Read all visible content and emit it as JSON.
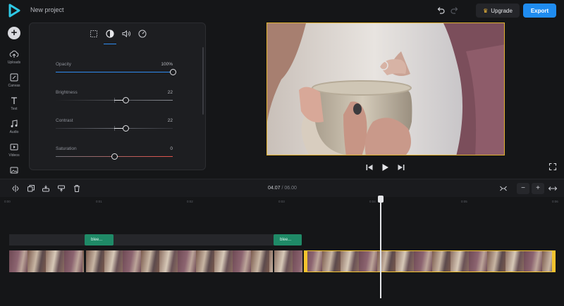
{
  "header": {
    "project_title": "New project",
    "upgrade_label": "Upgrade",
    "export_label": "Export",
    "accent_color": "#1f8cf0"
  },
  "sidebar": {
    "items": [
      {
        "label": "Uploads",
        "icon": "upload-icon"
      },
      {
        "label": "Canvas",
        "icon": "canvas-icon"
      },
      {
        "label": "Text",
        "icon": "text-icon"
      },
      {
        "label": "Audio",
        "icon": "music-icon"
      },
      {
        "label": "Videos",
        "icon": "video-icon"
      },
      {
        "label": "",
        "icon": "image-icon"
      }
    ]
  },
  "adjust_panel": {
    "tabs": [
      "crop-icon",
      "contrast-icon",
      "volume-icon",
      "speed-icon"
    ],
    "active_tab": 1,
    "sliders": [
      {
        "name": "Opacity",
        "value": "100%",
        "fraction": 1.0,
        "color": "#2f8cf2"
      },
      {
        "name": "Brightness",
        "value": "22",
        "fraction": 0.6,
        "color": "#e6e7ea"
      },
      {
        "name": "Contrast",
        "value": "22",
        "fraction": 0.6,
        "color": "#e6e7ea"
      },
      {
        "name": "Saturation",
        "value": "0",
        "fraction": 0.5,
        "color": "#e5534b"
      }
    ]
  },
  "timeline": {
    "current_time": "04.07",
    "separator": "/",
    "duration": "06.00",
    "ruler": [
      "0:00",
      "0:01",
      "0:02",
      "0:03",
      "0:04",
      "0:05",
      "0:06"
    ],
    "audio_clips": [
      "blee...",
      "blee..."
    ],
    "selection_color": "#f3c32e"
  }
}
